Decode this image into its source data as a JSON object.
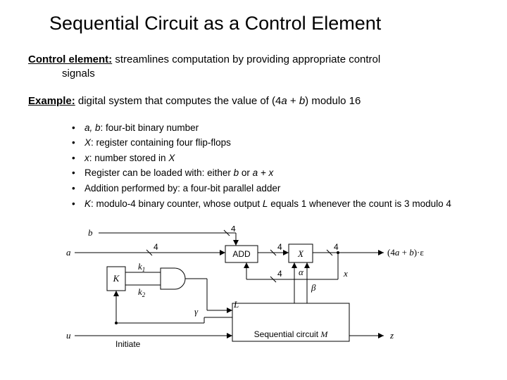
{
  "title": "Sequential Circuit as a Control Element",
  "p1": {
    "lead": "Control element:",
    "rest": " streamlines computation by providing appropriate control",
    "rest2": "signals"
  },
  "p2": {
    "lead": "Example:",
    "rest": " digital system that computes the value of (4",
    "a": "a",
    "plus": " + ",
    "b": "b",
    "tail": ") modulo 16"
  },
  "bullets": {
    "b1_ab": "a, b",
    "b1_rest": ": four-bit binary number",
    "b2_X": "X",
    "b2_rest": ": register containing four flip-flops",
    "b3_x": "x",
    "b3_rest": ": number stored in ",
    "b3_X": "X",
    "b4_a": "Register can be loaded with: either ",
    "b4_b": "b",
    "b4_c": " or ",
    "b4_d": "a + x",
    "b5": "Addition performed by: a four-bit parallel adder",
    "b6_a": "K",
    "b6_b": ": modulo-4 binary counter, whose output ",
    "b6_c": "L",
    "b6_d": " equals 1 whenever the count is 3 modulo 4"
  },
  "diag": {
    "b": "b",
    "a": "a",
    "K": "K",
    "u": "u",
    "k1": "k",
    "k1sub": "1",
    "k2": "k",
    "k2sub": "2",
    "gamma": "γ",
    "N4": "4",
    "ADD": "ADD",
    "X": "X",
    "L": "L",
    "Initiate": "Initiate",
    "Seq": "Sequential circuit ",
    "M": "M",
    "alpha": "α",
    "beta": "β",
    "x": "x",
    "out1": "(4",
    "out_a": "a",
    "out_plus": " + ",
    "out_b": "b",
    "out2": ")·",
    "out_eps": "ε",
    "z": "z"
  }
}
